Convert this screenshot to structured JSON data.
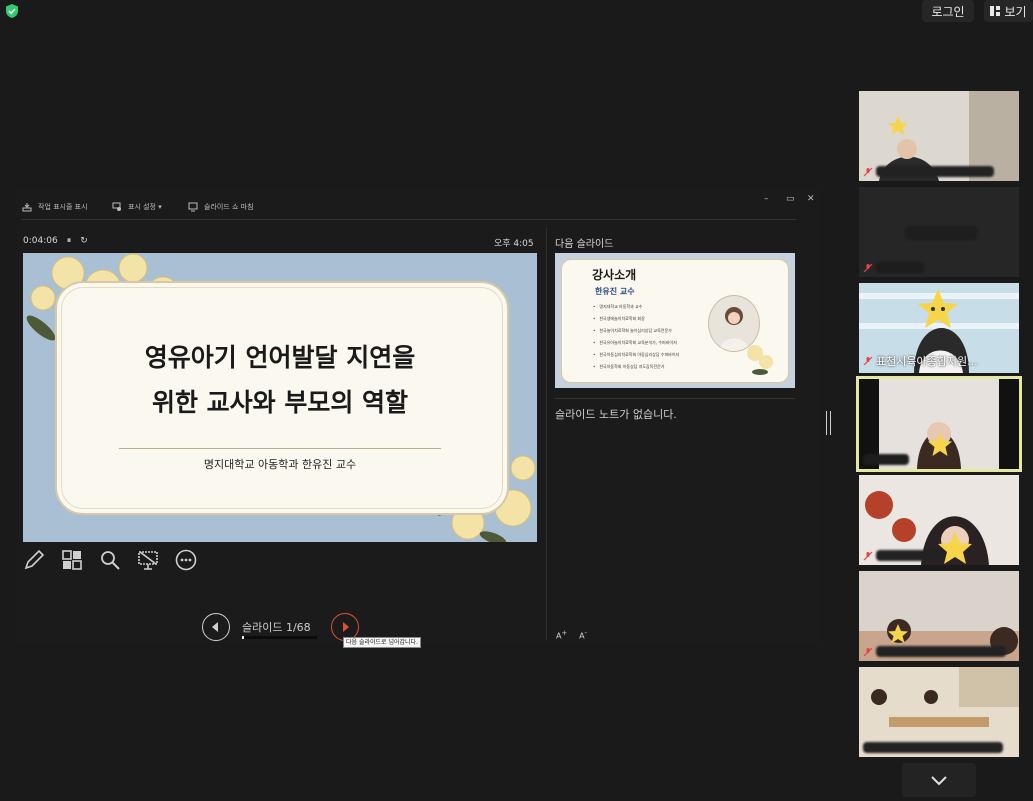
{
  "topbar": {
    "login_label": "로그인",
    "view_label": "보기"
  },
  "presenter": {
    "toolbar": {
      "show_taskbar": "작업 표시줄 표시",
      "display_settings": "표시 설정 ▾",
      "end_slideshow": "슬라이드 쇼 마침"
    },
    "window_controls": {
      "minimize": "–",
      "restore": "▭",
      "close": "✕"
    },
    "timer": "0:04:06",
    "clock": "오후 4:05",
    "next_slide_label": "다음 슬라이드",
    "current_slide": {
      "title_line1": "영유아기 언어발달 지연을",
      "title_line2": "위한 교사와 부모의 역할",
      "subtitle": "명지대학교 아동학과 한유진 교수"
    },
    "next_slide": {
      "title": "강사소개",
      "name": "한유진 교수",
      "bullets": [
        "명지대학교 아동학과 교수",
        "한국생애놀이치료학회 회장",
        "한국놀이치료학회 놀이심리상담 교육전문가",
        "한국유아놀이치료학회 교육분석가, 수퍼바이저",
        "한국아동심리치료학회 아동심리상담 수퍼바이저",
        "한국아동학회 아동상담 지도감독전문가"
      ]
    },
    "notes": "슬라이드 노트가 없습니다.",
    "slide_counter": "슬라이드 1/68",
    "slide_progress": 0.0147,
    "tooltip": "다음 슬라이드로 넘어갑니다.",
    "font_up": "A",
    "font_down": "A"
  },
  "participants": [
    {
      "name": "",
      "muted": true
    },
    {
      "name": "",
      "muted": true
    },
    {
      "name": "표천시육아종합지원...",
      "muted": true
    },
    {
      "name": "",
      "muted": false,
      "active": true
    },
    {
      "name": "",
      "muted": true
    },
    {
      "name": "",
      "muted": true
    },
    {
      "name": "",
      "muted": false
    }
  ],
  "colors": {
    "active_border": "#e5e8a1",
    "next_button": "#e0522d",
    "shield": "#2ecc71"
  }
}
